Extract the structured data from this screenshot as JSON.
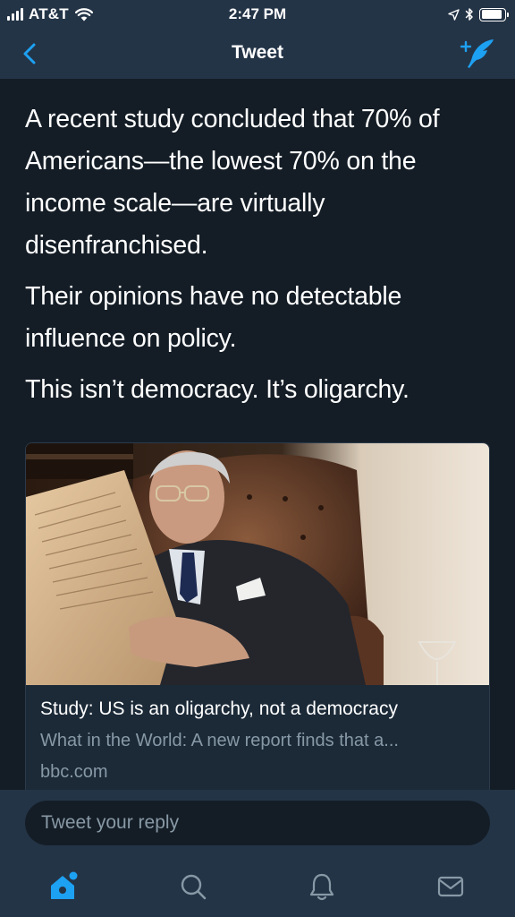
{
  "status_bar": {
    "carrier": "AT&T",
    "time": "2:47 PM",
    "signal_bars": 4,
    "battery_level": 0.9
  },
  "nav": {
    "title": "Tweet",
    "back_icon": "chevron-left-icon",
    "compose_icon": "compose-tweet-icon"
  },
  "tweet": {
    "paragraphs": [
      "A recent study concluded that 70% of Americans—the lowest 70% on the income scale—are virtually disenfranchised.",
      "Their opinions have no detectable influence on policy.",
      "This isn’t democracy. It’s oligarchy."
    ]
  },
  "card": {
    "title": "Study: US is an oligarchy, not a democracy",
    "description": "What in the World: A new report finds that a...",
    "domain": "bbc.com"
  },
  "reply": {
    "placeholder": "Tweet your reply"
  },
  "tabs": [
    {
      "name": "home",
      "icon": "home-icon",
      "active": true
    },
    {
      "name": "search",
      "icon": "search-icon",
      "active": false
    },
    {
      "name": "notifications",
      "icon": "bell-icon",
      "active": false
    },
    {
      "name": "messages",
      "icon": "mail-icon",
      "active": false
    }
  ],
  "colors": {
    "accent": "#1da1f2",
    "background": "#141d26",
    "bar": "#243447",
    "secondary_text": "#8899a6"
  }
}
